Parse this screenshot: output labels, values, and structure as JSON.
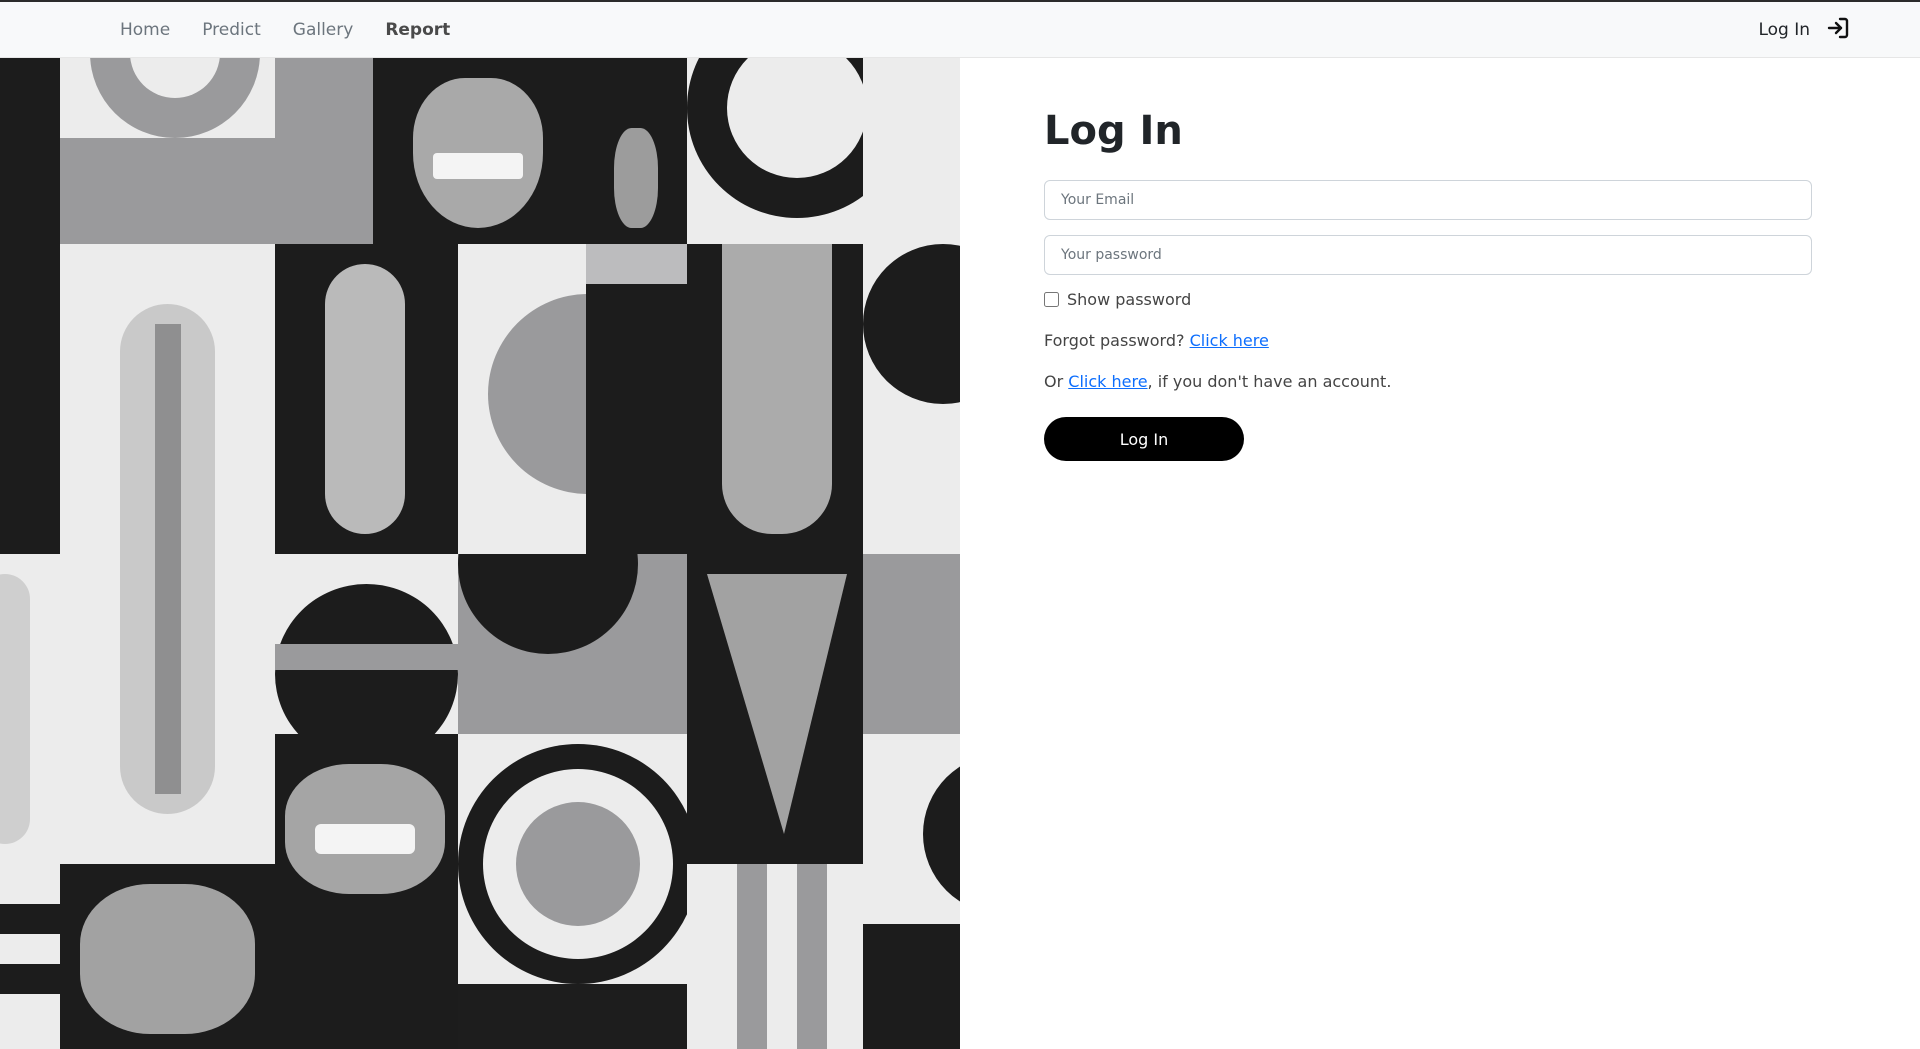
{
  "nav": {
    "links": [
      {
        "label": "Home"
      },
      {
        "label": "Predict"
      },
      {
        "label": "Gallery"
      },
      {
        "label": "Report"
      }
    ],
    "login_label": "Log In",
    "login_icon": "sign-in-icon"
  },
  "form": {
    "title": "Log In",
    "email_placeholder": "Your Email",
    "password_placeholder": "Your password",
    "show_password_label": "Show password",
    "forgot_text": "Forgot password?",
    "forgot_link": "Click here",
    "signup_prefix": "Or",
    "signup_link": "Click here",
    "signup_suffix": ", if you don't have an account.",
    "submit_label": "Log In"
  },
  "colors": {
    "navbar_bg": "#f8f9fa",
    "button_bg": "#000000",
    "link": "#0d6efd"
  }
}
